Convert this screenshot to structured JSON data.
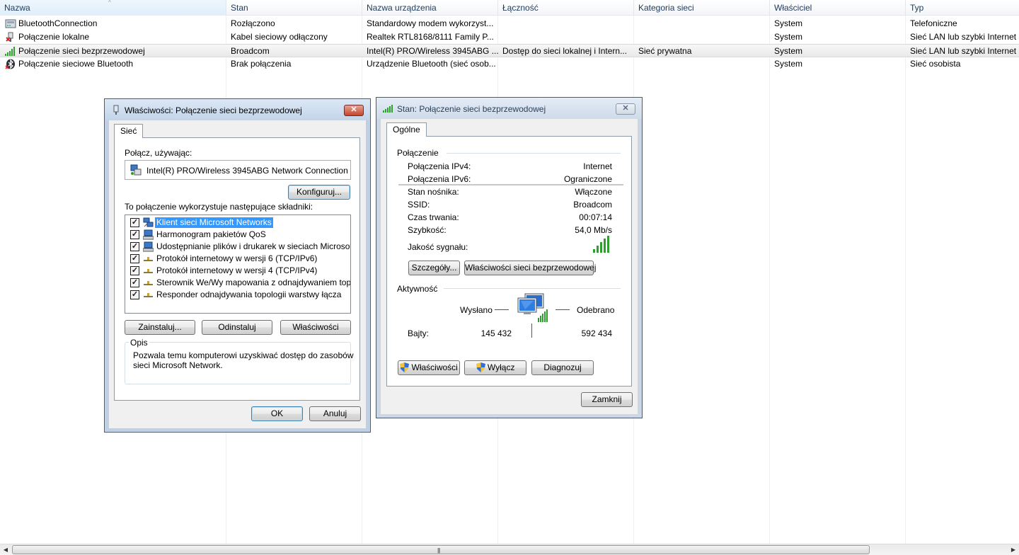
{
  "columns": [
    "Nazwa",
    "Stan",
    "Nazwa urządzenia",
    "Łączność",
    "Kategoria sieci",
    "Właściciel",
    "Typ"
  ],
  "sort_indicator": "^",
  "rows": [
    {
      "name": "BluetoothConnection",
      "status": "Rozłączono",
      "device": "Standardowy modem wykorzyst...",
      "connectivity": "",
      "category": "",
      "owner": "System",
      "type": "Telefoniczne",
      "icon": "modem-icon"
    },
    {
      "name": "Połączenie lokalne",
      "status": "Kabel sieciowy odłączony",
      "device": "Realtek RTL8168/8111 Family P...",
      "connectivity": "",
      "category": "",
      "owner": "System",
      "type": "Sieć LAN lub szybki Internet",
      "icon": "lan-disconnected-icon"
    },
    {
      "name": "Połączenie sieci bezprzewodowej",
      "status": "Broadcom",
      "device": "Intel(R) PRO/Wireless 3945ABG ...",
      "connectivity": "Dostęp do sieci lokalnej i Intern...",
      "category": "Sieć prywatna",
      "owner": "System",
      "type": "Sieć LAN lub szybki Internet",
      "icon": "wireless-signal-icon",
      "selected": true
    },
    {
      "name": "Połączenie sieciowe Bluetooth",
      "status": "Brak połączenia",
      "device": "Urządzenie Bluetooth (sieć osob...",
      "connectivity": "",
      "category": "",
      "owner": "System",
      "type": "Sieć osobista",
      "icon": "bluetooth-icon"
    }
  ],
  "props": {
    "title": "Właściwości: Połączenie sieci bezprzewodowej",
    "close": "✕",
    "tab": "Sieć",
    "connect_using_label": "Połącz, używając:",
    "adapter": "Intel(R) PRO/Wireless 3945ABG Network Connection",
    "configure": "Konfiguruj...",
    "components_label": "To połączenie wykorzystuje następujące składniki:",
    "components": [
      {
        "label": "Klient sieci Microsoft Networks",
        "checked": true,
        "selected": true
      },
      {
        "label": "Harmonogram pakietów QoS",
        "checked": true
      },
      {
        "label": "Udostępnianie plików i drukarek w sieciach Microsoft N...",
        "checked": true
      },
      {
        "label": "Protokół internetowy w wersji 6 (TCP/IPv6)",
        "checked": true
      },
      {
        "label": "Protokół internetowy w wersji 4 (TCP/IPv4)",
        "checked": true
      },
      {
        "label": "Sterownik We/Wy mapowania z odnajdywaniem topolo...",
        "checked": true
      },
      {
        "label": "Responder odnajdywania topologii warstwy łącza",
        "checked": true
      }
    ],
    "install": "Zainstaluj...",
    "uninstall": "Odinstaluj",
    "properties": "Właściwości",
    "description_label": "Opis",
    "description_line1": "Pozwala temu komputerowi uzyskiwać dostęp do zasobów",
    "description_line2": "sieci Microsoft Network.",
    "ok": "OK",
    "cancel": "Anuluj"
  },
  "status": {
    "title": "Stan: Połączenie sieci bezprzewodowej",
    "close": "✕",
    "tab": "Ogólne",
    "connection_label": "Połączenie",
    "ipv4_label": "Połączenia IPv4:",
    "ipv4_value": "Internet",
    "ipv6_label": "Połączenia IPv6:",
    "ipv6_value": "Ograniczone",
    "media_label": "Stan nośnika:",
    "media_value": "Włączone",
    "ssid_label": "SSID:",
    "ssid_value": "Broadcom",
    "duration_label": "Czas trwania:",
    "duration_value": "00:07:14",
    "speed_label": "Szybkość:",
    "speed_value": "54,0 Mb/s",
    "signal_label": "Jakość sygnału:",
    "signal_bars": 5,
    "details": "Szczegóły...",
    "wireless_props": "Właściwości sieci bezprzewodowej",
    "activity_label": "Aktywność",
    "sent_label": "Wysłano",
    "received_label": "Odebrano",
    "bytes_label": "Bajty:",
    "bytes_sent": "145 432",
    "bytes_received": "592 434",
    "properties": "Właściwości",
    "disable": "Wyłącz",
    "diagnose": "Diagnozuj",
    "close_button": "Zamknij"
  },
  "colors": {
    "selection": "#3399ff",
    "header_text": "#1e395b",
    "signal": "#2e9e2e"
  }
}
